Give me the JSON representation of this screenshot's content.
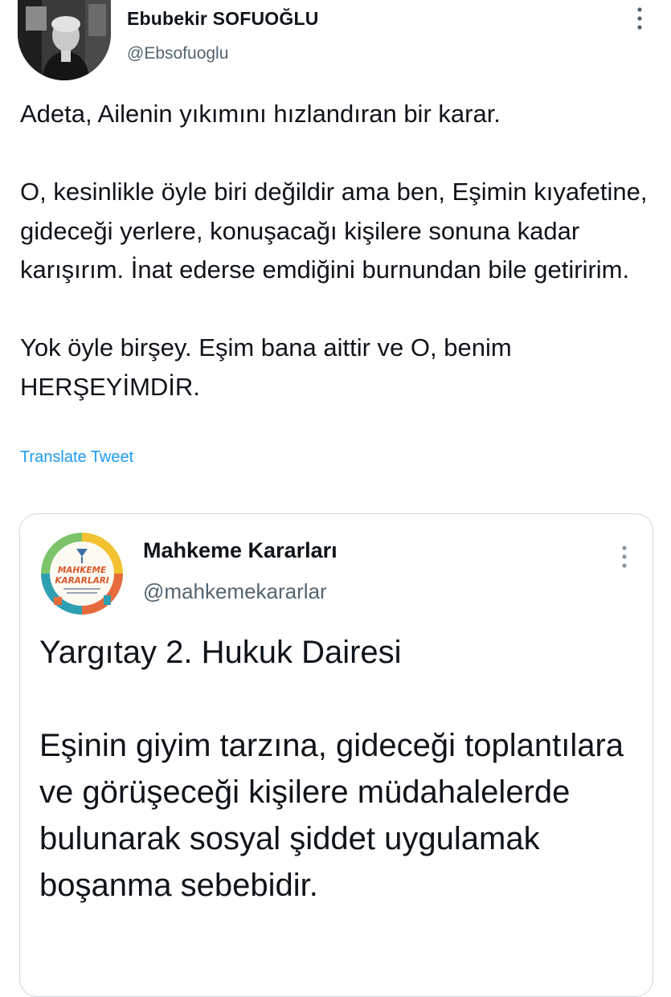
{
  "author": {
    "name": "Ebubekir SOFUOĞLU",
    "handle": "@Ebsofuoglu",
    "avatar_icon": "profile-photo"
  },
  "tweet": {
    "text": "Adeta, Ailenin yıkımını hızlandıran bir karar.\n\nO, kesinlikle öyle biri değildir ama ben, Eşimin kıyafetine, gideceği yerlere, konuşacağı kişilere sonuna kadar karışırım. İnat ederse emdiğini burnundan bile getiririm.\n\nYok öyle birşey. Eşim bana aittir ve O, benim HERŞEYİMDİR.",
    "translate_label": "Translate Tweet"
  },
  "quoted_tweet": {
    "author_name": "Mahkeme Kararları",
    "author_handle": "@mahkemekararlar",
    "avatar_logo_line1": "MAHKEME",
    "avatar_logo_line2": "KARARLARI",
    "text": "Yargıtay 2. Hukuk Dairesi\n\nEşinin giyim tarzına, gideceği toplantılara ve görüşeceği kişilere müdahalelerde bulunarak sosyal şiddet uygulamak boşanma sebebidir."
  },
  "icons": {
    "more": "more-vertical-icon"
  },
  "colors": {
    "link": "#1d9bf0",
    "secondary_text": "#536471",
    "primary_text": "#0f1419",
    "border": "#cfd9de"
  }
}
